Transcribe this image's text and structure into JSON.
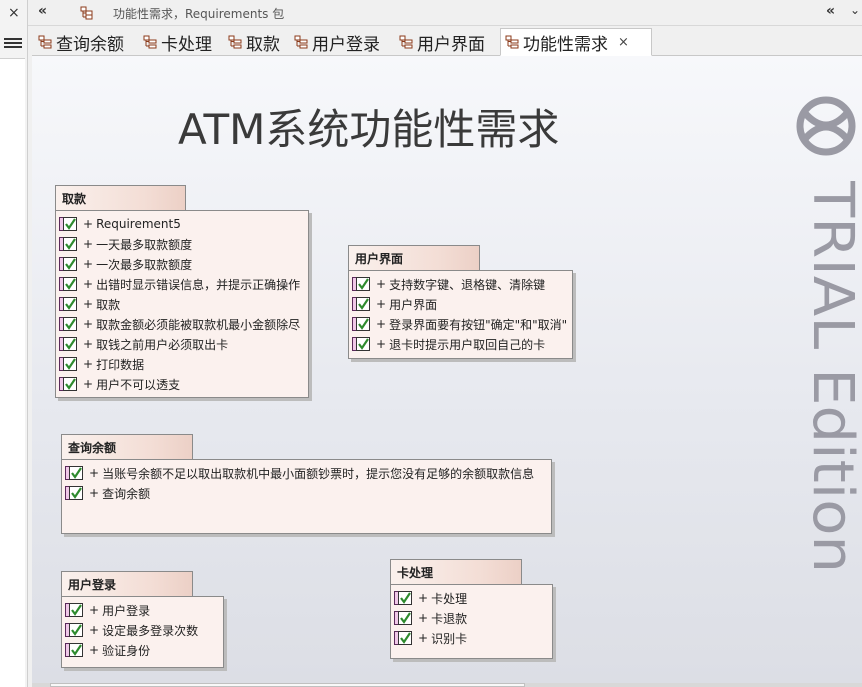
{
  "topbar": {
    "breadcrumb": "功能性需求，Requirements 包",
    "close_glyph": "×",
    "collapse_glyph": "«",
    "collapse_right_glyph": "«",
    "dropdown_glyph": "⌄"
  },
  "tabs": [
    {
      "label": "查询余额"
    },
    {
      "label": "卡处理"
    },
    {
      "label": "取款"
    },
    {
      "label": "用户登录"
    },
    {
      "label": "用户界面"
    },
    {
      "label": "功能性需求",
      "close": "×"
    }
  ],
  "diagram": {
    "title": "ATM系统功能性需求",
    "watermark": "TRIAL Edition",
    "item_prefix": "+",
    "packages": [
      {
        "name": "取款",
        "items": [
          "Requirement5",
          "一天最多取款额度",
          "一次最多取款额度",
          "出错时显示错误信息，并提示正确操作",
          "取款",
          "取款金额必须能被取款机最小金额除尽",
          "取钱之前用户必须取出卡",
          "打印数据",
          "用户不可以透支"
        ]
      },
      {
        "name": "用户界面",
        "items": [
          "支持数字键、退格键、清除键",
          "用户界面",
          "登录界面要有按钮\"确定\"和\"取消\"",
          "退卡时提示用户取回自己的卡"
        ]
      },
      {
        "name": "查询余额",
        "items": [
          "当账号余额不足以取出取款机中最小面额钞票时，提示您没有足够的余额取款信息",
          "查询余额"
        ]
      },
      {
        "name": "用户登录",
        "items": [
          "用户登录",
          "设定最多登录次数",
          "验证身份"
        ]
      },
      {
        "name": "卡处理",
        "items": [
          "卡处理",
          "卡退款",
          "识别卡"
        ]
      }
    ]
  },
  "colors": {
    "package_fill": "#fbf1ee",
    "package_tab": "#f3ddd5",
    "check_green": "#2e8b2e",
    "watermark": "#9a9aa4"
  }
}
